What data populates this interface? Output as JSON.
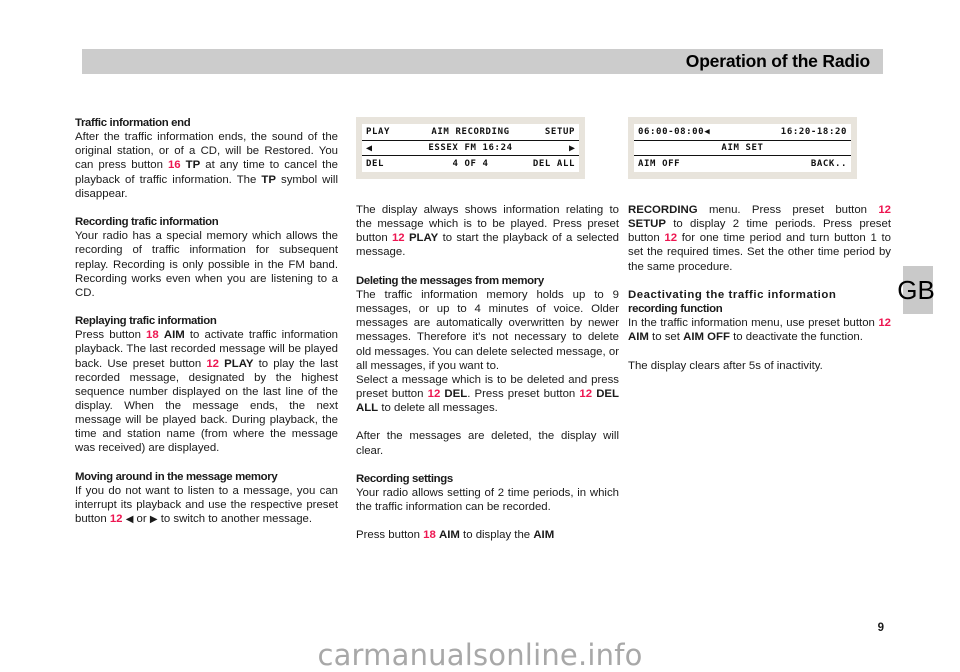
{
  "header": {
    "title": "Operation of the Radio"
  },
  "country_tab": {
    "label": "GB"
  },
  "footer": {
    "page_number": "9",
    "watermark": "carmanualsonline.info"
  },
  "displays": [
    {
      "name": "aim-recording-display",
      "row1": {
        "left": "PLAY",
        "center": "AIM RECORDING",
        "right": "SETUP"
      },
      "row2": {
        "left": "◀",
        "center": "ESSEX FM 16:24",
        "right": "▶"
      },
      "row3": {
        "left": "DEL",
        "center": "4 OF 4",
        "right": "DEL ALL"
      }
    },
    {
      "name": "aim-set-display",
      "row1": {
        "left": "06:00-08:00◀",
        "center": "",
        "right": "16:20-18:20"
      },
      "row2": {
        "left": "",
        "center": "AIM SET",
        "right": ""
      },
      "row3": {
        "left": "AIM OFF",
        "center": "",
        "right": "BACK.."
      }
    }
  ],
  "column1": {
    "s1_heading": "Traffic information end",
    "s1_p1_a": "After the traffic information ends, the sound of the original station, or of a CD, will be Restored. You can press button ",
    "s1_p1_num": "16",
    "s1_p1_kw": "TP",
    "s1_p1_b": " at any time to cancel the playback of traffic information. The ",
    "s1_p1_kw2": "TP",
    "s1_p1_c": " symbol will disappear.",
    "s2_heading": "Recording trafic information",
    "s2_p1": "Your radio has a special memory which allows the recording of traffic information for subsequent replay. Recording is only possible in the FM band. Recording works even when you are listening to a CD.",
    "s3_heading": "Replaying trafic information",
    "s3_p1_a": "Press button ",
    "s3_p1_num1": "18",
    "s3_p1_kw1": "AIM",
    "s3_p1_b": " to activate traffic information playback. The last recorded message will be played back. Use preset button ",
    "s3_p1_num2": "12",
    "s3_p1_kw2": "PLAY",
    "s3_p1_c": " to play the last recorded message, designated by the highest sequence number displayed on the last line of the display. When the message ends, the next message will be played back. During playback, the time and station name (from where the message was received) are displayed.",
    "s4_heading": "Moving around in the message memory",
    "s4_p1_a": "If you do not want to listen to a message, you can interrupt its playback and use the respective preset button ",
    "s4_p1_num": "12",
    "s4_p1_arrow1": "◀",
    "s4_p1_or": " or ",
    "s4_p1_arrow2": "▶",
    "s4_p1_b": " to switch to another message."
  },
  "column2": {
    "s1_p1_a": "The display always shows information relating to the message which is to be played. Press preset button ",
    "s1_p1_num": "12",
    "s1_p1_kw": "PLAY",
    "s1_p1_b": " to start the playback of a selected message.",
    "s2_heading": "Deleting the messages from memory",
    "s2_p1": "The traffic information memory holds up to 9 messages, or up to 4 minutes of voice. Older messages are automatically overwritten by newer messages. Therefore it's not necessary to delete old messages. You can delete selected message, or all messages, if you want to.",
    "s2_p2_a": "Select a message which is to be deleted and press preset button ",
    "s2_p2_num1": "12",
    "s2_p2_kw1": "DEL",
    "s2_p2_b": ". Press preset button ",
    "s2_p2_num2": "12",
    "s2_p2_kw2": "DEL ALL",
    "s2_p2_c": " to delete all messages.",
    "s2_p3": "After the messages are deleted, the display will clear.",
    "s3_heading": "Recording settings",
    "s3_p1": "Your radio allows setting of 2 time periods, in which the traffic information can be recorded.",
    "s3_p2_a": "Press button ",
    "s3_p2_num": "18",
    "s3_p2_kw1": "AIM",
    "s3_p2_b": " to display the ",
    "s3_p2_kw2": "AIM"
  },
  "column3": {
    "s1_p1_kw1": "RECORDING",
    "s1_p1_a": " menu. Press preset button ",
    "s1_p1_num1": "12",
    "s1_p1_kw2": "SETUP",
    "s1_p1_b": " to display 2 time periods. Press preset button ",
    "s1_p1_num2": "12",
    "s1_p1_c": " for one time period and turn button 1 to set the required times. Set the other time period by the same procedure.",
    "s2_heading_l1": "Deactivating the traffic information",
    "s2_heading_l2": "recording function",
    "s2_p1_a": "In the traffic information menu, use preset button ",
    "s2_p1_num": "12",
    "s2_p1_kw1": "AIM",
    "s2_p1_b": " to set ",
    "s2_p1_kw2": "AIM OFF",
    "s2_p1_c": " to deactivate the function.",
    "s2_p2": "The display clears after 5s of inactivity."
  }
}
